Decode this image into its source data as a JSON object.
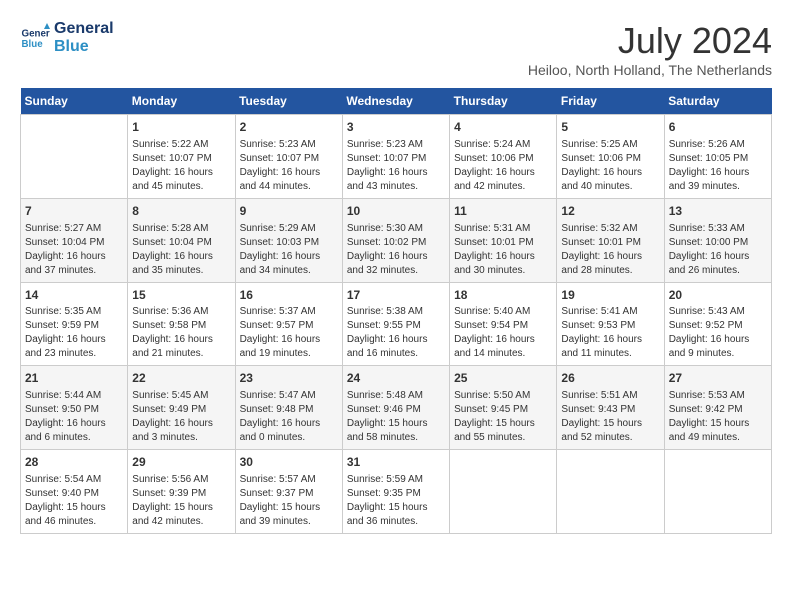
{
  "header": {
    "logo_line1": "General",
    "logo_line2": "Blue",
    "month_year": "July 2024",
    "location": "Heiloo, North Holland, The Netherlands"
  },
  "days_of_week": [
    "Sunday",
    "Monday",
    "Tuesday",
    "Wednesday",
    "Thursday",
    "Friday",
    "Saturday"
  ],
  "weeks": [
    [
      {
        "day": "",
        "info": ""
      },
      {
        "day": "1",
        "info": "Sunrise: 5:22 AM\nSunset: 10:07 PM\nDaylight: 16 hours\nand 45 minutes."
      },
      {
        "day": "2",
        "info": "Sunrise: 5:23 AM\nSunset: 10:07 PM\nDaylight: 16 hours\nand 44 minutes."
      },
      {
        "day": "3",
        "info": "Sunrise: 5:23 AM\nSunset: 10:07 PM\nDaylight: 16 hours\nand 43 minutes."
      },
      {
        "day": "4",
        "info": "Sunrise: 5:24 AM\nSunset: 10:06 PM\nDaylight: 16 hours\nand 42 minutes."
      },
      {
        "day": "5",
        "info": "Sunrise: 5:25 AM\nSunset: 10:06 PM\nDaylight: 16 hours\nand 40 minutes."
      },
      {
        "day": "6",
        "info": "Sunrise: 5:26 AM\nSunset: 10:05 PM\nDaylight: 16 hours\nand 39 minutes."
      }
    ],
    [
      {
        "day": "7",
        "info": "Sunrise: 5:27 AM\nSunset: 10:04 PM\nDaylight: 16 hours\nand 37 minutes."
      },
      {
        "day": "8",
        "info": "Sunrise: 5:28 AM\nSunset: 10:04 PM\nDaylight: 16 hours\nand 35 minutes."
      },
      {
        "day": "9",
        "info": "Sunrise: 5:29 AM\nSunset: 10:03 PM\nDaylight: 16 hours\nand 34 minutes."
      },
      {
        "day": "10",
        "info": "Sunrise: 5:30 AM\nSunset: 10:02 PM\nDaylight: 16 hours\nand 32 minutes."
      },
      {
        "day": "11",
        "info": "Sunrise: 5:31 AM\nSunset: 10:01 PM\nDaylight: 16 hours\nand 30 minutes."
      },
      {
        "day": "12",
        "info": "Sunrise: 5:32 AM\nSunset: 10:01 PM\nDaylight: 16 hours\nand 28 minutes."
      },
      {
        "day": "13",
        "info": "Sunrise: 5:33 AM\nSunset: 10:00 PM\nDaylight: 16 hours\nand 26 minutes."
      }
    ],
    [
      {
        "day": "14",
        "info": "Sunrise: 5:35 AM\nSunset: 9:59 PM\nDaylight: 16 hours\nand 23 minutes."
      },
      {
        "day": "15",
        "info": "Sunrise: 5:36 AM\nSunset: 9:58 PM\nDaylight: 16 hours\nand 21 minutes."
      },
      {
        "day": "16",
        "info": "Sunrise: 5:37 AM\nSunset: 9:57 PM\nDaylight: 16 hours\nand 19 minutes."
      },
      {
        "day": "17",
        "info": "Sunrise: 5:38 AM\nSunset: 9:55 PM\nDaylight: 16 hours\nand 16 minutes."
      },
      {
        "day": "18",
        "info": "Sunrise: 5:40 AM\nSunset: 9:54 PM\nDaylight: 16 hours\nand 14 minutes."
      },
      {
        "day": "19",
        "info": "Sunrise: 5:41 AM\nSunset: 9:53 PM\nDaylight: 16 hours\nand 11 minutes."
      },
      {
        "day": "20",
        "info": "Sunrise: 5:43 AM\nSunset: 9:52 PM\nDaylight: 16 hours\nand 9 minutes."
      }
    ],
    [
      {
        "day": "21",
        "info": "Sunrise: 5:44 AM\nSunset: 9:50 PM\nDaylight: 16 hours\nand 6 minutes."
      },
      {
        "day": "22",
        "info": "Sunrise: 5:45 AM\nSunset: 9:49 PM\nDaylight: 16 hours\nand 3 minutes."
      },
      {
        "day": "23",
        "info": "Sunrise: 5:47 AM\nSunset: 9:48 PM\nDaylight: 16 hours\nand 0 minutes."
      },
      {
        "day": "24",
        "info": "Sunrise: 5:48 AM\nSunset: 9:46 PM\nDaylight: 15 hours\nand 58 minutes."
      },
      {
        "day": "25",
        "info": "Sunrise: 5:50 AM\nSunset: 9:45 PM\nDaylight: 15 hours\nand 55 minutes."
      },
      {
        "day": "26",
        "info": "Sunrise: 5:51 AM\nSunset: 9:43 PM\nDaylight: 15 hours\nand 52 minutes."
      },
      {
        "day": "27",
        "info": "Sunrise: 5:53 AM\nSunset: 9:42 PM\nDaylight: 15 hours\nand 49 minutes."
      }
    ],
    [
      {
        "day": "28",
        "info": "Sunrise: 5:54 AM\nSunset: 9:40 PM\nDaylight: 15 hours\nand 46 minutes."
      },
      {
        "day": "29",
        "info": "Sunrise: 5:56 AM\nSunset: 9:39 PM\nDaylight: 15 hours\nand 42 minutes."
      },
      {
        "day": "30",
        "info": "Sunrise: 5:57 AM\nSunset: 9:37 PM\nDaylight: 15 hours\nand 39 minutes."
      },
      {
        "day": "31",
        "info": "Sunrise: 5:59 AM\nSunset: 9:35 PM\nDaylight: 15 hours\nand 36 minutes."
      },
      {
        "day": "",
        "info": ""
      },
      {
        "day": "",
        "info": ""
      },
      {
        "day": "",
        "info": ""
      }
    ]
  ]
}
